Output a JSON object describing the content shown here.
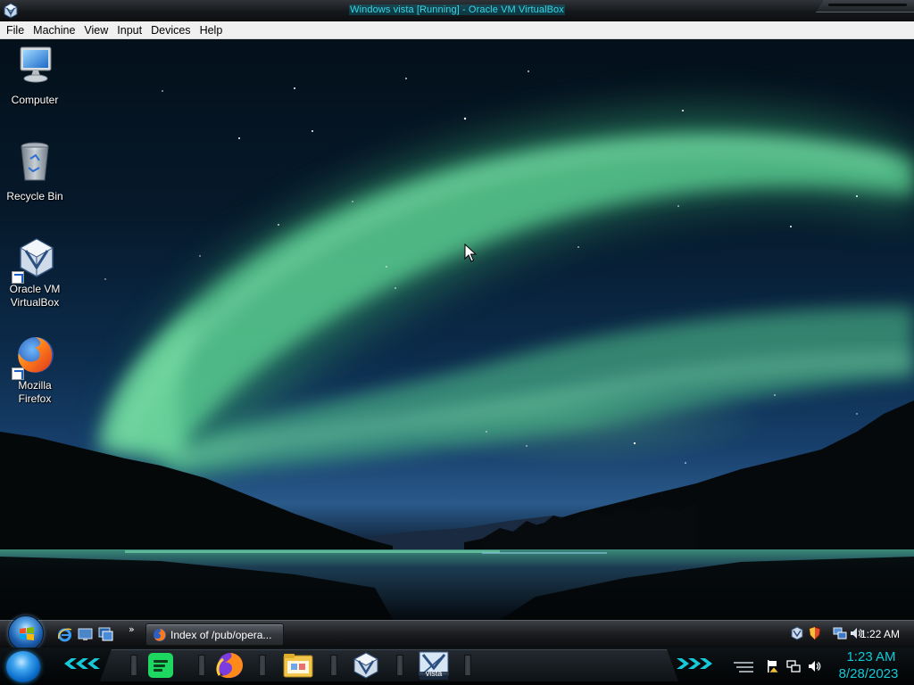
{
  "window": {
    "title": "Windows vista [Running] - Oracle VM VirtualBox",
    "app_icon": "virtualbox-icon"
  },
  "menubar": {
    "items": [
      "File",
      "Machine",
      "View",
      "Input",
      "Devices",
      "Help"
    ]
  },
  "desktop": {
    "wallpaper": "aurora-over-lake",
    "icons": [
      {
        "label": "Computer",
        "icon": "computer-icon",
        "shortcut": false
      },
      {
        "label": "Recycle Bin",
        "icon": "recycle-bin-icon",
        "shortcut": false
      },
      {
        "label": "Oracle VM VirtualBox",
        "icon": "virtualbox-icon",
        "shortcut": true
      },
      {
        "label": "Mozilla Firefox",
        "icon": "firefox-icon",
        "shortcut": true
      }
    ]
  },
  "guest_taskbar": {
    "start_button": "start-orb",
    "quick_launch": [
      "internet-explorer-icon",
      "show-desktop-icon",
      "switch-windows-icon"
    ],
    "quick_launch_more": "»",
    "task_button_label": "Index of /pub/opera...",
    "tray_icons": [
      "virtualbox-tray-icon",
      "security-shield-icon",
      "network-icon",
      "volume-icon"
    ],
    "clock": "1:22 AM"
  },
  "host_taskbar": {
    "dock_apps": [
      "spotify-icon",
      "firefox-icon",
      "file-manager-icon",
      "virtualbox-icon",
      "virtualbox-vista-icon"
    ],
    "active_label": "vista",
    "tray_icons": [
      "action-center-flag-icon",
      "network-icon",
      "volume-icon"
    ],
    "time": "1:23 AM",
    "date": "8/28/2023"
  },
  "colors": {
    "title_text": "#37d7e6",
    "host_clock": "#12c9d6",
    "menubar_bg": "#f0f0f0"
  }
}
